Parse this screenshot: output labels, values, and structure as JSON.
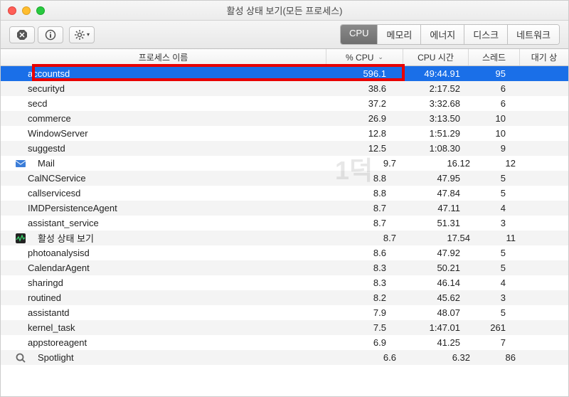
{
  "window": {
    "title": "활성 상태 보기(모든 프로세스)"
  },
  "tabs": {
    "items": [
      {
        "label": "CPU",
        "active": true
      },
      {
        "label": "메모리",
        "active": false
      },
      {
        "label": "에너지",
        "active": false
      },
      {
        "label": "디스크",
        "active": false
      },
      {
        "label": "네트워크",
        "active": false
      }
    ]
  },
  "columns": {
    "name": "프로세스 이름",
    "cpu": "% CPU",
    "time": "CPU 시간",
    "threads": "스레드",
    "wait": "대기 상",
    "sort_col": "cpu",
    "sort_dir": "desc"
  },
  "processes": [
    {
      "icon": "none",
      "name": "accountsd",
      "cpu": "596.1",
      "time": "49:44.91",
      "threads": "95",
      "selected": true,
      "highlighted": true
    },
    {
      "icon": "none",
      "name": "securityd",
      "cpu": "38.6",
      "time": "2:17.52",
      "threads": "6"
    },
    {
      "icon": "none",
      "name": "secd",
      "cpu": "37.2",
      "time": "3:32.68",
      "threads": "6"
    },
    {
      "icon": "none",
      "name": "commerce",
      "cpu": "26.9",
      "time": "3:13.50",
      "threads": "10"
    },
    {
      "icon": "none",
      "name": "WindowServer",
      "cpu": "12.8",
      "time": "1:51.29",
      "threads": "10"
    },
    {
      "icon": "none",
      "name": "suggestd",
      "cpu": "12.5",
      "time": "1:08.30",
      "threads": "9"
    },
    {
      "icon": "mail",
      "name": "Mail",
      "cpu": "9.7",
      "time": "16.12",
      "threads": "12"
    },
    {
      "icon": "none",
      "name": "CalNCService",
      "cpu": "8.8",
      "time": "47.95",
      "threads": "5"
    },
    {
      "icon": "none",
      "name": "callservicesd",
      "cpu": "8.8",
      "time": "47.84",
      "threads": "5"
    },
    {
      "icon": "none",
      "name": "IMDPersistenceAgent",
      "cpu": "8.7",
      "time": "47.11",
      "threads": "4"
    },
    {
      "icon": "none",
      "name": "assistant_service",
      "cpu": "8.7",
      "time": "51.31",
      "threads": "3"
    },
    {
      "icon": "activity",
      "name": "활성 상태 보기",
      "cpu": "8.7",
      "time": "17.54",
      "threads": "11"
    },
    {
      "icon": "none",
      "name": "photoanalysisd",
      "cpu": "8.6",
      "time": "47.92",
      "threads": "5"
    },
    {
      "icon": "none",
      "name": "CalendarAgent",
      "cpu": "8.3",
      "time": "50.21",
      "threads": "5"
    },
    {
      "icon": "none",
      "name": "sharingd",
      "cpu": "8.3",
      "time": "46.14",
      "threads": "4"
    },
    {
      "icon": "none",
      "name": "routined",
      "cpu": "8.2",
      "time": "45.62",
      "threads": "3"
    },
    {
      "icon": "none",
      "name": "assistantd",
      "cpu": "7.9",
      "time": "48.07",
      "threads": "5"
    },
    {
      "icon": "none",
      "name": "kernel_task",
      "cpu": "7.5",
      "time": "1:47.01",
      "threads": "261"
    },
    {
      "icon": "none",
      "name": "appstoreagent",
      "cpu": "6.9",
      "time": "41.25",
      "threads": "7"
    },
    {
      "icon": "spotlight",
      "name": "Spotlight",
      "cpu": "6.6",
      "time": "6.32",
      "threads": "86"
    }
  ],
  "watermark": "1덕"
}
